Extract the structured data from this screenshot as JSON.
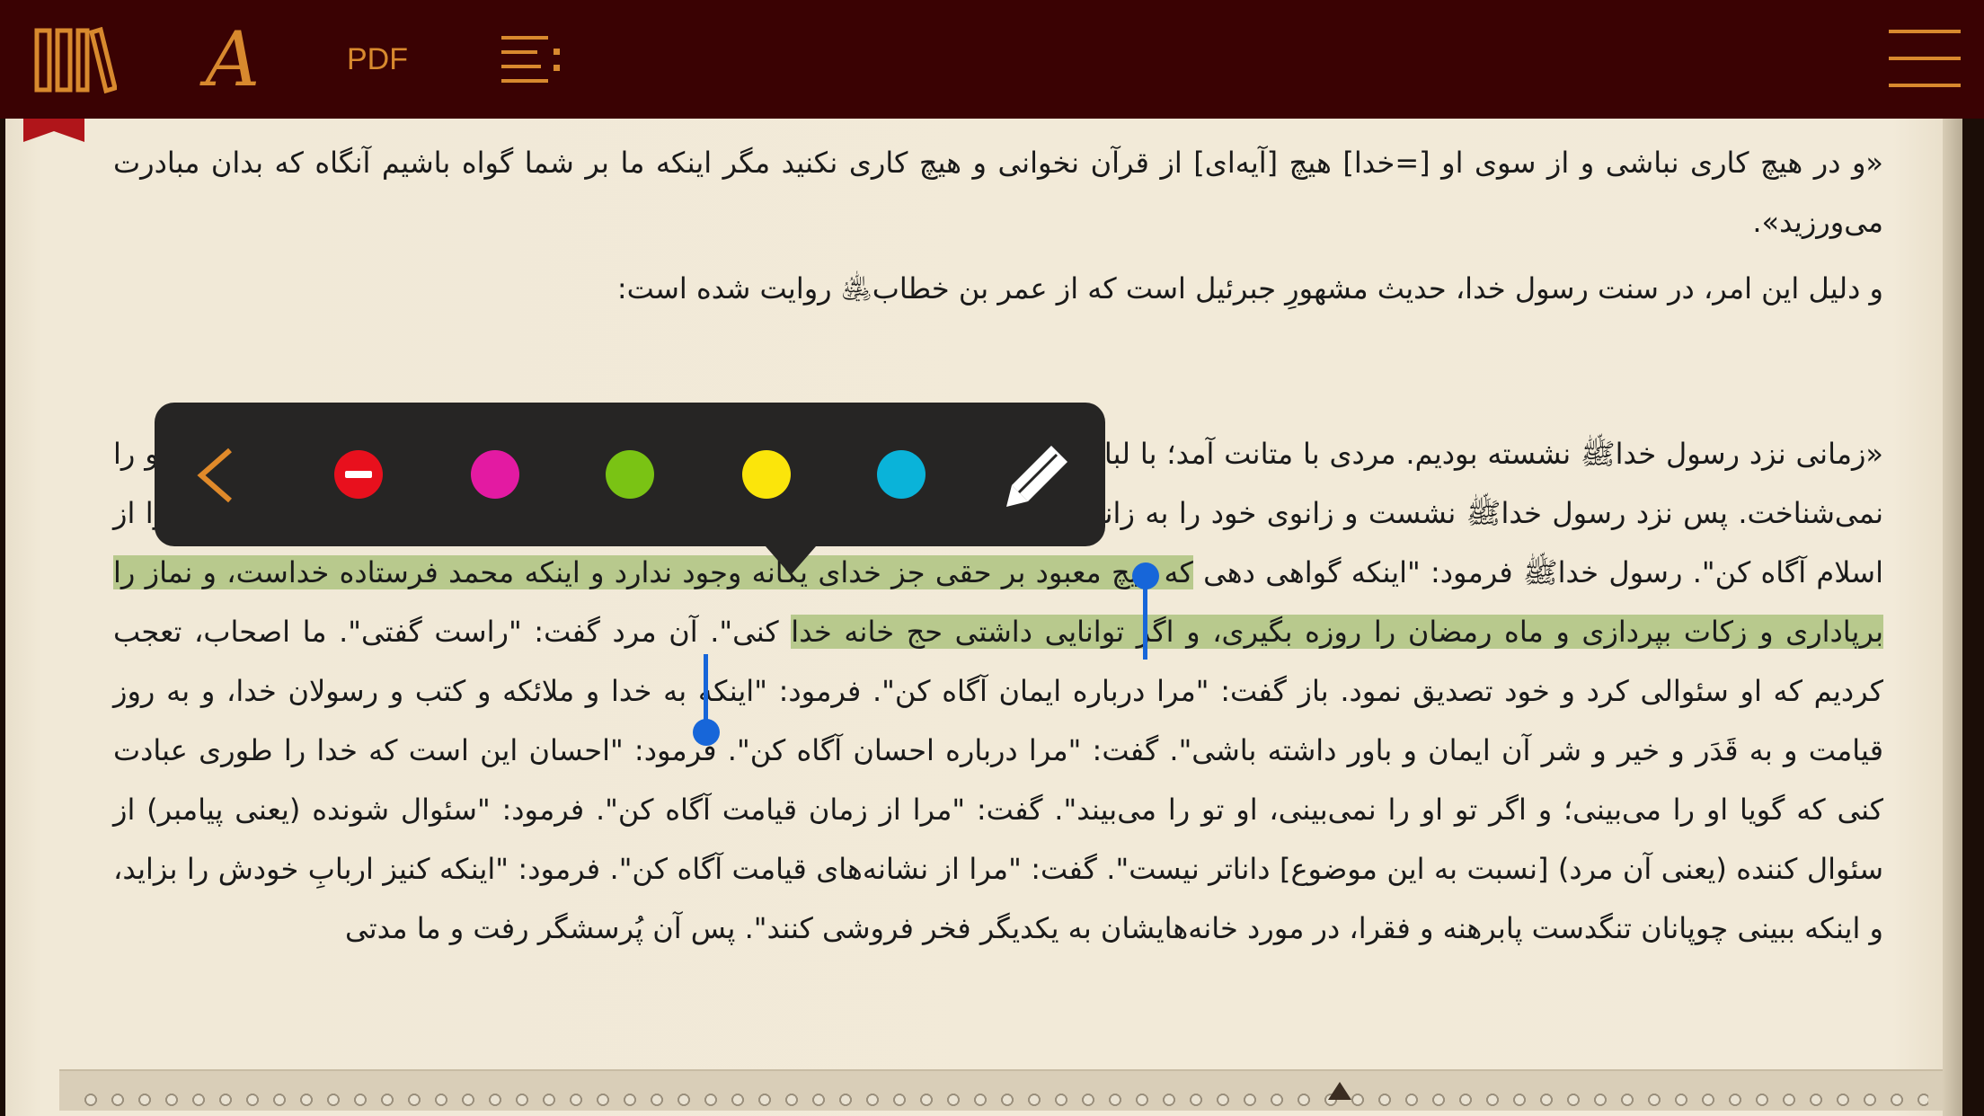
{
  "toolbar": {
    "library_icon": "library-books-icon",
    "font_icon_glyph": "A",
    "pdf_label": "PDF",
    "toc_icon": "table-of-contents-icon",
    "menu_icon": "hamburger-menu-icon"
  },
  "book": {
    "paragraphs": [
      "«و در هیچ کاری نباشی و از سوی او [=خدا] هیچ [آیه‌ای] از قرآن نخوانی و هیچ کاری نکنید مگر اینکه ما بر شما گواه باشیم آنگاه که بدان مبادرت می‌ورزید».",
      "و دلیل این امر، در سنت رسول خدا، حدیث مشهورِ جبرئیل است که از عمر بن خطاب﵁ روایت شده است:"
    ],
    "hadith": {
      "before_highlight": "«زمانی نزد رسول خداﷺ نشسته بودیم. مردی با متانت آمد؛ با لباس سپید و موی مشکی. از ظاهرش پیدا بود که مسافر نیست و هیچکدام از ما او را نمی‌شناخت. پس نزد رسول خداﷺ نشست و زانوی خود را به زانوی رسول خداﷺ گذاشت و دست خود را بر پاشنه پا نهاد و گفت: \"یا محمد، مرا از اسلام آگاه کن\". رسول خداﷺ فرمود: \"اینکه گواهی دهی ",
      "highlighted": "که هیچ معبود بر حقی جز خدای یگانه وجود ندارد و اینکه محمد فرستاده خداست، و نماز را برپاداری و زکات بپردازی و ماه رمضان را روزه بگیری، و اگر توانایی داشتی حج خانه خدا",
      "after_highlight": " کنی\". آن مرد گفت: \"راست گفتی\". ما اصحاب، تعجب کردیم که او سئوالی کرد و خود تصدیق نمود. باز گفت: \"مرا درباره ایمان آگاه کن\". فرمود: \"اینکه به خدا و ملائکه و کتب و رسولان خدا، و به روز قیامت و به قَدَر و خیر و شر آن ایمان و باور داشته باشی\". گفت: \"مرا درباره احسان آگاه کن\". فرمود: \"احسان این است که خدا را طوری عبادت کنی که گویا او را می‌بینی؛ و اگر تو او را نمی‌بینی، او تو را می‌بیند\". گفت: \"مرا از زمان قیامت آگاه کن\". فرمود: \"سئوال شونده (یعنی پیامبر) از سئوال کننده (یعنی آن مرد) [نسبت به این موضوع] داناتر نیست\". گفت: \"مرا از نشانه‌های قیامت آگاه کن\". فرمود: \"اینکه کنیز اربابِ خودش را بزاید، و اینکه ببینی چوپانان تنگدست پابرهنه و فقرا، در مورد خانه‌هایشان به یکدیگر فخر فروشی کنند\". پس آن پُرسشگر رفت و ما مدتی"
    }
  },
  "highlight_popover": {
    "back_icon": "chevron-left-icon",
    "remove_icon": "remove-highlight-icon",
    "colors": {
      "remove": "#e8101d",
      "magenta": "#e31aa2",
      "green": "#7ac314",
      "yellow": "#fbe50b",
      "cyan": "#0ab3d9"
    },
    "note_icon": "pencil-icon"
  },
  "theme": {
    "toolbar_bg": "#3a0203",
    "toolbar_accent": "#d8892e",
    "page_bg": "#f2ead9",
    "highlight_color": "#b8c98d",
    "selection_handle_color": "#1766d9"
  }
}
